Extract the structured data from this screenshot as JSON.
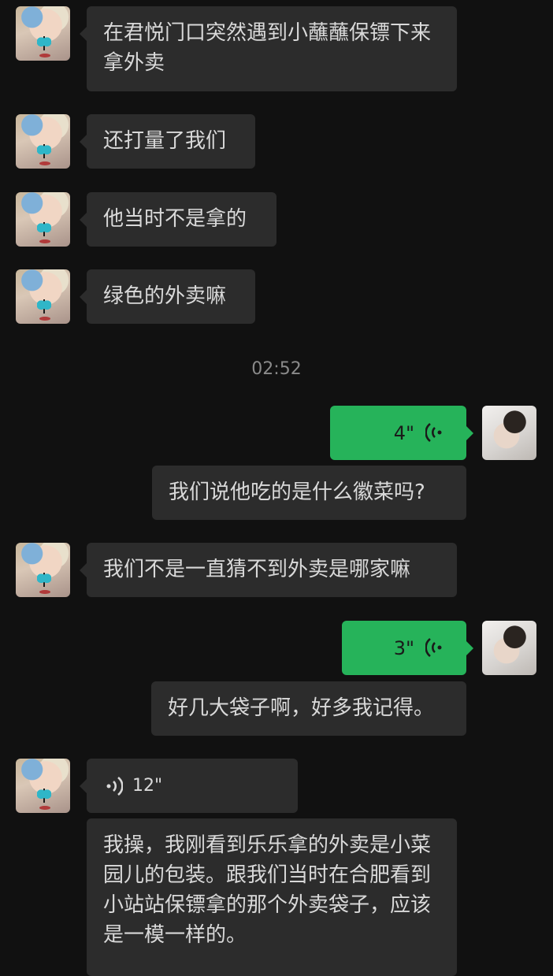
{
  "messages": {
    "m1": "在君悦门口突然遇到小蘸蘸保镖下来拿外卖",
    "m2": "还打量了我们",
    "m3": "他当时不是拿的",
    "m4": "绿色的外卖嘛",
    "timestamp": "02:52",
    "voice1_duration": "4\"",
    "voice1_transcript": "我们说他吃的是什么徽菜吗?",
    "m5": "我们不是一直猜不到外卖是哪家嘛",
    "voice2_duration": "3\"",
    "voice2_transcript": "好几大袋子啊，好多我记得。",
    "voice3_duration": "12\"",
    "voice3_transcript": "我操，我刚看到乐乐拿的外卖是小菜园儿的包装。跟我们当时在合肥看到小站站保镖拿的那个外卖袋子，应该是一模一样的。"
  },
  "colors": {
    "background": "#111111",
    "incoming_bubble": "#2c2c2c",
    "outgoing_voice": "#26b35a",
    "timestamp_text": "#8a8a8a"
  },
  "icons": {
    "voice_wave": "voice-wave-icon"
  }
}
